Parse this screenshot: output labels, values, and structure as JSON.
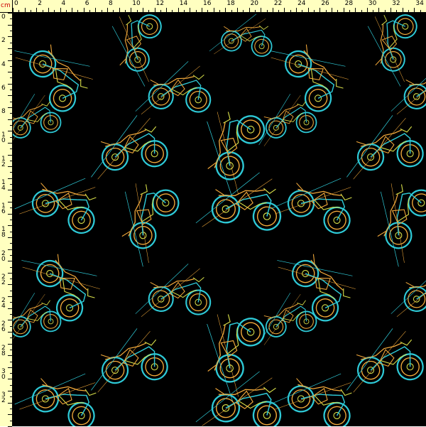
{
  "ruler": {
    "unit": "cm",
    "top_labels": [
      "0",
      "2",
      "4",
      "6",
      "8",
      "10",
      "12",
      "14",
      "16",
      "18",
      "20",
      "22",
      "24",
      "26",
      "28",
      "30",
      "32",
      "34"
    ],
    "left_labels": [
      "0",
      "2",
      "4",
      "6",
      "8",
      "10",
      "12",
      "14",
      "16",
      "18",
      "20",
      "22",
      "24",
      "26",
      "28",
      "30",
      "32"
    ],
    "tick_color": "#000000",
    "background_color": "#ffffc0"
  },
  "fabric": {
    "description_icon": "motorcycle-pattern",
    "background_color": "#000000",
    "line_colors": [
      "#2ec9d6",
      "#f2a93b",
      "#d8e04a"
    ]
  }
}
